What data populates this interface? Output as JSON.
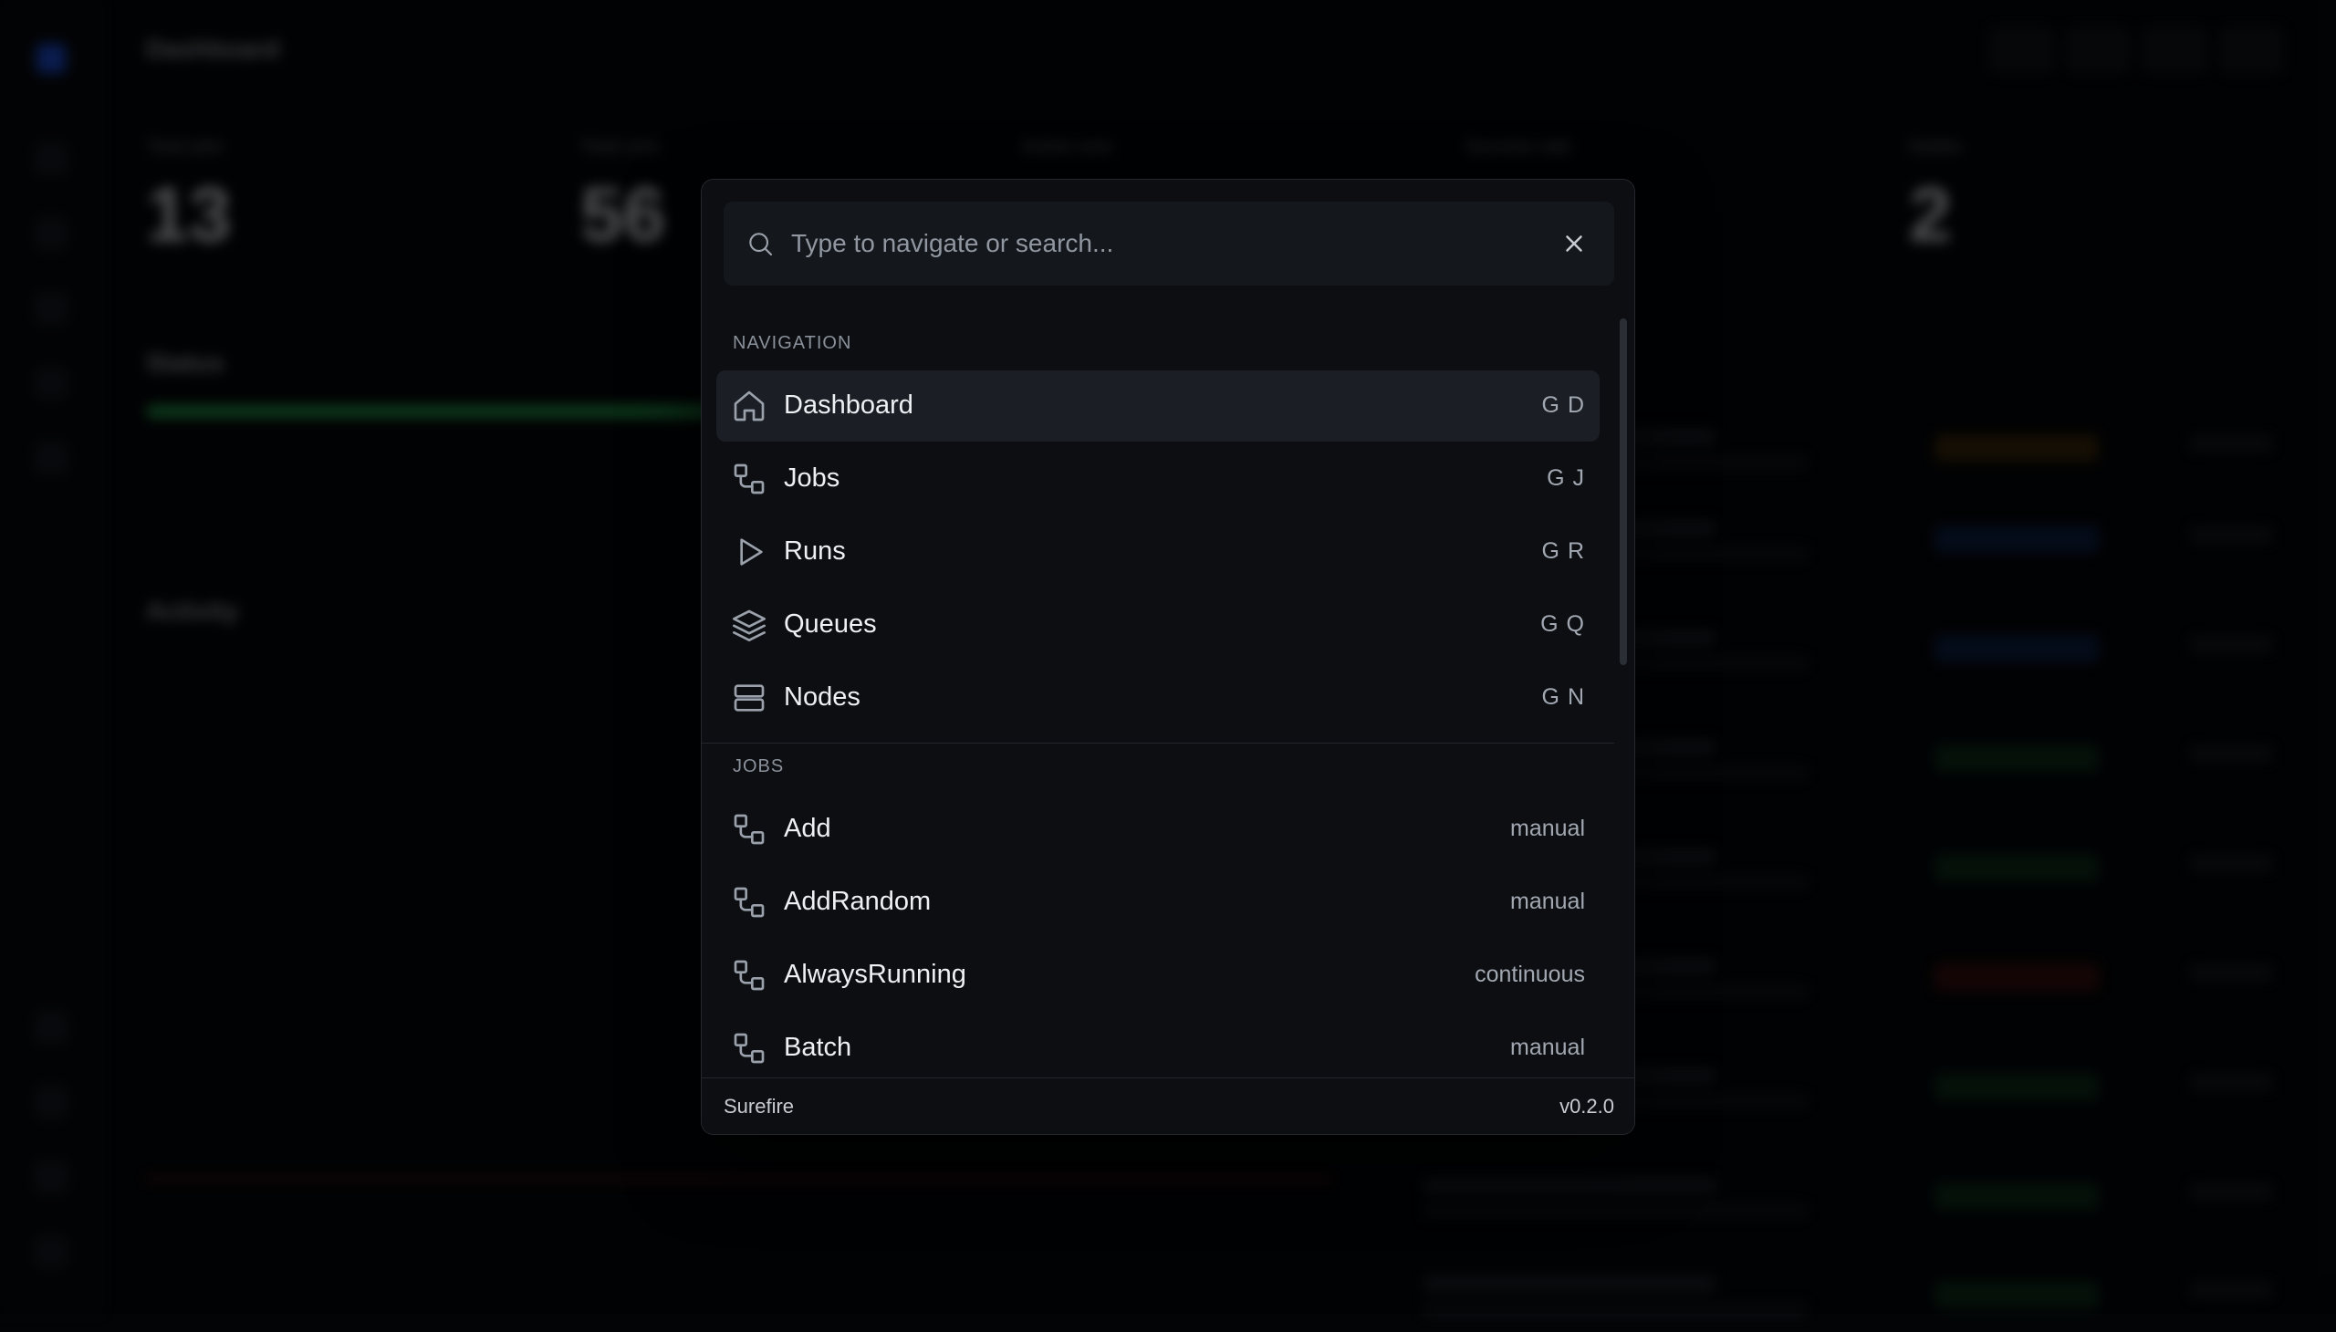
{
  "background": {
    "page_title": "Dashboard",
    "stats": [
      {
        "label": "Total jobs",
        "value": "13"
      },
      {
        "label": "Total runs",
        "value": "56"
      },
      {
        "label": "Active runs",
        "value": ""
      },
      {
        "label": "Success rate",
        "value": ""
      },
      {
        "label": "Nodes",
        "value": "2"
      }
    ],
    "sections": {
      "status": "Status",
      "activity": "Activity"
    }
  },
  "palette": {
    "search": {
      "value": "",
      "placeholder": "Type to navigate or search..."
    },
    "sections": {
      "navigation": "NAVIGATION",
      "jobs": "JOBS"
    },
    "navigation": [
      {
        "label": "Dashboard",
        "shortcut": "G D",
        "icon": "home-icon"
      },
      {
        "label": "Jobs",
        "shortcut": "G J",
        "icon": "workflow-icon"
      },
      {
        "label": "Runs",
        "shortcut": "G R",
        "icon": "play-icon"
      },
      {
        "label": "Queues",
        "shortcut": "G Q",
        "icon": "layers-icon"
      },
      {
        "label": "Nodes",
        "shortcut": "G N",
        "icon": "server-icon"
      }
    ],
    "jobs": [
      {
        "label": "Add",
        "trigger": "manual",
        "icon": "workflow-icon"
      },
      {
        "label": "AddRandom",
        "trigger": "manual",
        "icon": "workflow-icon"
      },
      {
        "label": "AlwaysRunning",
        "trigger": "continuous",
        "icon": "workflow-icon"
      },
      {
        "label": "Batch",
        "trigger": "manual",
        "icon": "workflow-icon"
      }
    ],
    "footer": {
      "brand": "Surefire",
      "version": "v0.2.0"
    }
  },
  "colors": {
    "palette_bg": "#0c0e12",
    "active_item": "#1b1f25",
    "muted_text": "#8a919b"
  }
}
